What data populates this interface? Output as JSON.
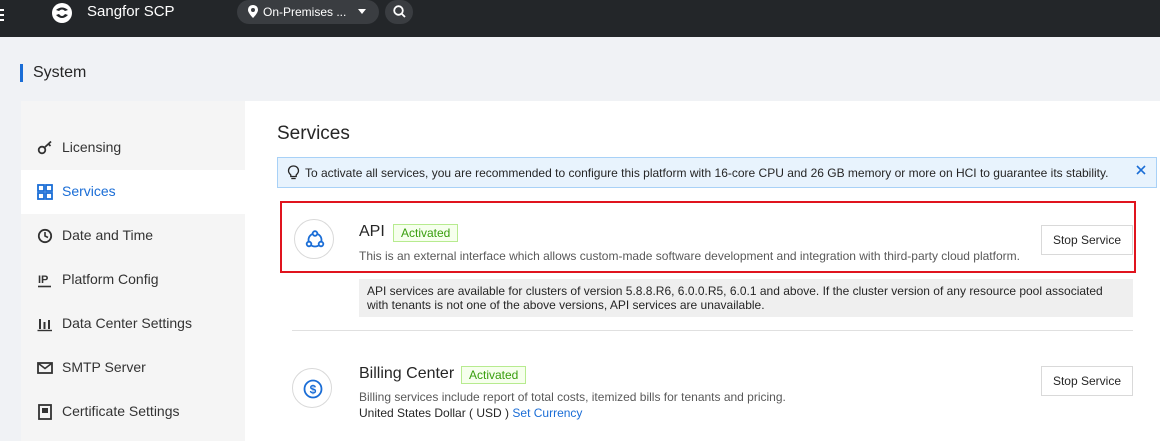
{
  "header": {
    "app_title": "Sangfor SCP",
    "region": "On-Premises ...",
    "icons": [
      "menu-icon",
      "sangfor-logo",
      "location-pin-icon",
      "caret-down-icon",
      "search-icon"
    ]
  },
  "page": {
    "title": "System"
  },
  "sidebar": {
    "items": [
      {
        "label": "Licensing",
        "icon": "key-icon"
      },
      {
        "label": "Services",
        "icon": "grid-icon"
      },
      {
        "label": "Date and Time",
        "icon": "clock-icon"
      },
      {
        "label": "Platform Config",
        "icon": "ip-icon"
      },
      {
        "label": "Data Center Settings",
        "icon": "bar-chart-icon"
      },
      {
        "label": "SMTP Server",
        "icon": "mail-icon"
      },
      {
        "label": "Certificate Settings",
        "icon": "certificate-icon"
      }
    ],
    "active_label": "Services"
  },
  "main": {
    "title": "Services",
    "tip": "To activate all services, you are recommended to configure this platform with 16-core CPU and 26 GB memory or more on HCI to guarantee its stability.",
    "services": [
      {
        "name": "API",
        "status": "Activated",
        "description": "This is an external interface which allows custom-made software development and integration with third-party cloud platform.",
        "button": "Stop Service",
        "note_line1": "API services are available for clusters of version 5.8.8.R6, 6.0.0.R5, 6.0.1 and above. If the cluster version of any resource pool associated",
        "note_line2": "with tenants is not one of the above versions, API services are unavailable."
      },
      {
        "name": "Billing Center",
        "status": "Activated",
        "description": "Billing services include report of total costs, itemized bills for tenants and pricing.",
        "button": "Stop Service",
        "currency": "United States Dollar ( USD )",
        "currency_link": "Set Currency"
      }
    ]
  },
  "colors": {
    "topbar": "#232629",
    "accent": "#1a6dd6",
    "highlight_border": "#e0141e",
    "activated_green": "#389e0d"
  }
}
